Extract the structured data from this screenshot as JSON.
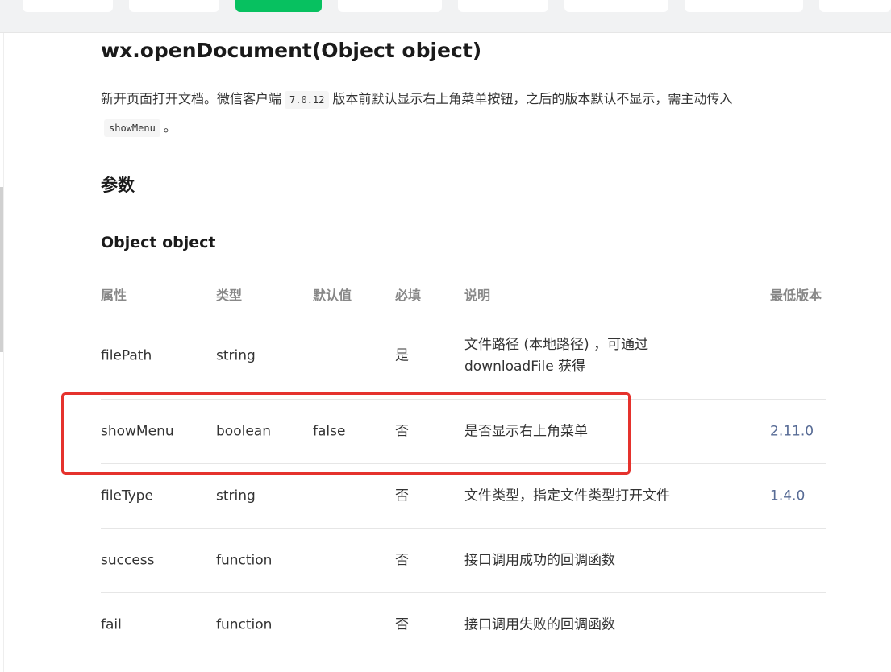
{
  "page": {
    "title": "wx.openDocument(Object object)",
    "description_before": "新开页面打开文档。微信客户端",
    "version_code": "7.0.12",
    "description_middle": "版本前默认显示右上角菜单按钮，之后的版本默认不显示，需主动传入",
    "param_code": "showMenu",
    "description_end": "。",
    "params_heading": "参数",
    "object_heading": "Object object"
  },
  "table": {
    "headers": {
      "name": "属性",
      "type": "类型",
      "default": "默认值",
      "required": "必填",
      "description": "说明",
      "version": "最低版本"
    },
    "rows": [
      {
        "name": "filePath",
        "type": "string",
        "default": "",
        "required": "是",
        "description": "文件路径 (本地路径) ，可通过 downloadFile 获得",
        "version": ""
      },
      {
        "name": "showMenu",
        "type": "boolean",
        "default": "false",
        "required": "否",
        "description": "是否显示右上角菜单",
        "version": "2.11.0"
      },
      {
        "name": "fileType",
        "type": "string",
        "default": "",
        "required": "否",
        "description": "文件类型，指定文件类型打开文件",
        "version": "1.4.0"
      },
      {
        "name": "success",
        "type": "function",
        "default": "",
        "required": "否",
        "description": "接口调用成功的回调函数",
        "version": ""
      },
      {
        "name": "fail",
        "type": "function",
        "default": "",
        "required": "否",
        "description": "接口调用失败的回调函数",
        "version": ""
      }
    ]
  },
  "colors": {
    "accent_tab": "#07c160",
    "version_link": "#576b95",
    "highlight_border": "#e5322d"
  }
}
